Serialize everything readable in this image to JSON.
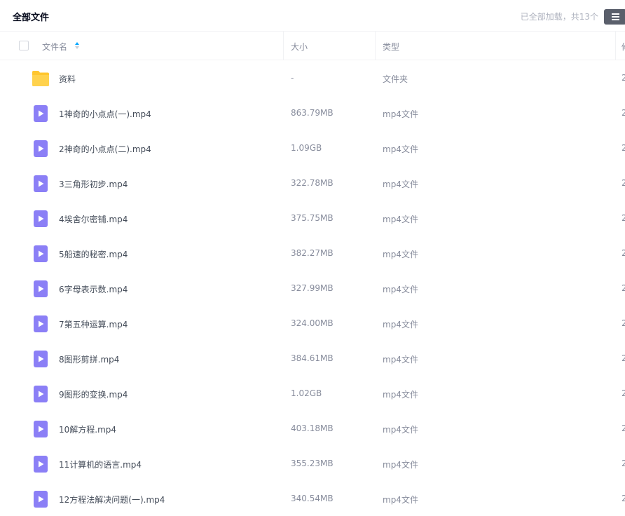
{
  "header": {
    "title": "全部文件",
    "summary": "已全部加载，共13个",
    "view_toggle_icon": "list-view-icon"
  },
  "columns": {
    "name": "文件名",
    "size": "大小",
    "type": "类型",
    "extra": "修"
  },
  "colors": {
    "folder": "#ffc62f",
    "video_icon": "#8b7ff6",
    "sort_active": "#06a7ff"
  },
  "files": [
    {
      "name": "资料",
      "size": "-",
      "type": "文件夹",
      "extra": "2",
      "icon": "folder-icon"
    },
    {
      "name": "1神奇的小点点(一).mp4",
      "size": "863.79MB",
      "type": "mp4文件",
      "extra": "2",
      "icon": "video-file-icon"
    },
    {
      "name": "2神奇的小点点(二).mp4",
      "size": "1.09GB",
      "type": "mp4文件",
      "extra": "2",
      "icon": "video-file-icon"
    },
    {
      "name": "3三角形初步.mp4",
      "size": "322.78MB",
      "type": "mp4文件",
      "extra": "2",
      "icon": "video-file-icon"
    },
    {
      "name": "4埃舍尔密铺.mp4",
      "size": "375.75MB",
      "type": "mp4文件",
      "extra": "2",
      "icon": "video-file-icon"
    },
    {
      "name": "5船速的秘密.mp4",
      "size": "382.27MB",
      "type": "mp4文件",
      "extra": "2",
      "icon": "video-file-icon"
    },
    {
      "name": "6字母表示数.mp4",
      "size": "327.99MB",
      "type": "mp4文件",
      "extra": "2",
      "icon": "video-file-icon"
    },
    {
      "name": "7第五种运算.mp4",
      "size": "324.00MB",
      "type": "mp4文件",
      "extra": "2",
      "icon": "video-file-icon"
    },
    {
      "name": "8图形剪拼.mp4",
      "size": "384.61MB",
      "type": "mp4文件",
      "extra": "2",
      "icon": "video-file-icon"
    },
    {
      "name": "9图形的变换.mp4",
      "size": "1.02GB",
      "type": "mp4文件",
      "extra": "2",
      "icon": "video-file-icon"
    },
    {
      "name": "10解方程.mp4",
      "size": "403.18MB",
      "type": "mp4文件",
      "extra": "2",
      "icon": "video-file-icon"
    },
    {
      "name": "11计算机的语言.mp4",
      "size": "355.23MB",
      "type": "mp4文件",
      "extra": "2",
      "icon": "video-file-icon"
    },
    {
      "name": "12方程法解决问题(一).mp4",
      "size": "340.54MB",
      "type": "mp4文件",
      "extra": "2",
      "icon": "video-file-icon"
    }
  ]
}
